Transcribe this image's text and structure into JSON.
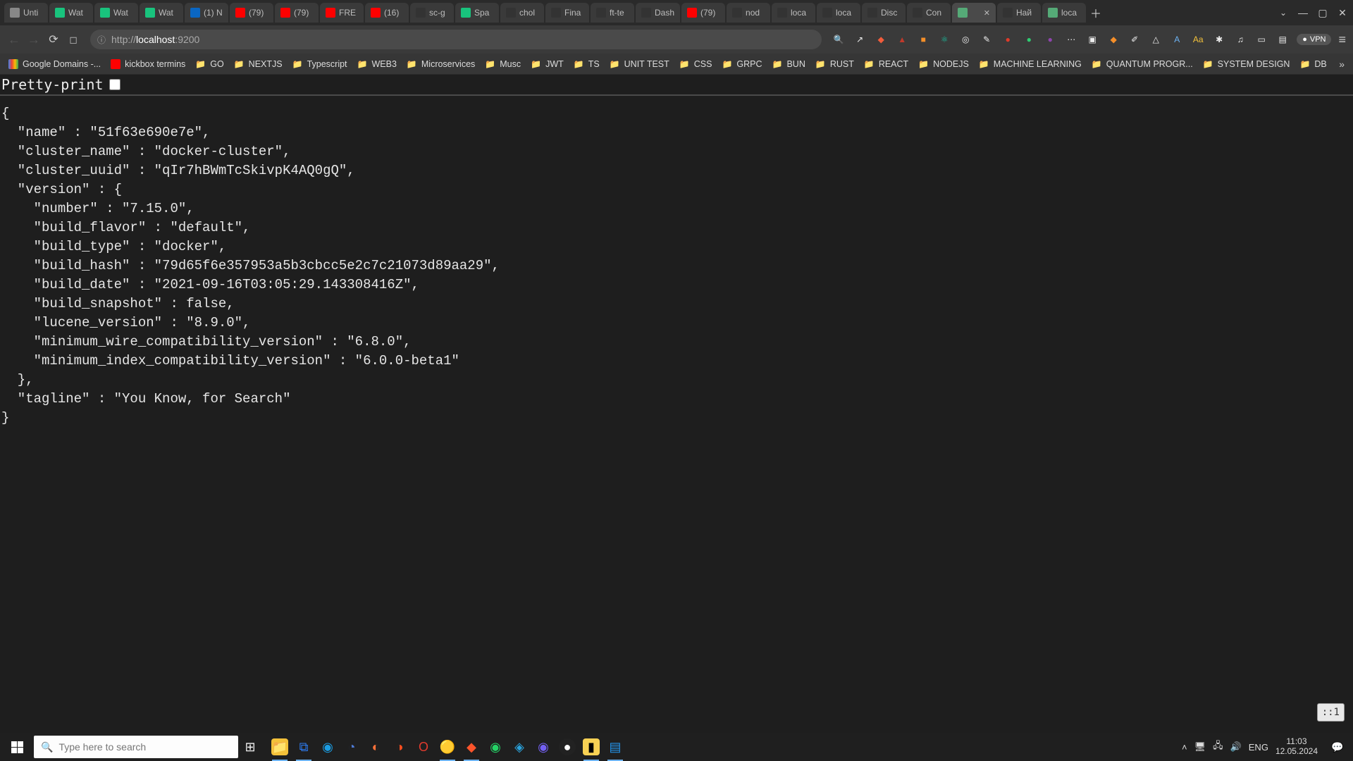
{
  "tabs": [
    {
      "title": "Unti"
    },
    {
      "title": "Wat"
    },
    {
      "title": "Wat"
    },
    {
      "title": "Wat"
    },
    {
      "title": "(1) N"
    },
    {
      "title": "(79)"
    },
    {
      "title": "(79)"
    },
    {
      "title": "FRE"
    },
    {
      "title": "(16)"
    },
    {
      "title": "sc-g"
    },
    {
      "title": "Spa"
    },
    {
      "title": "chol"
    },
    {
      "title": "Fina"
    },
    {
      "title": "ft-te"
    },
    {
      "title": "Dash"
    },
    {
      "title": "(79)"
    },
    {
      "title": "nod"
    },
    {
      "title": "loca"
    },
    {
      "title": "loca"
    },
    {
      "title": "Disc"
    },
    {
      "title": "Con"
    },
    {
      "title": ""
    },
    {
      "title": "Най"
    },
    {
      "title": "loca"
    }
  ],
  "url": {
    "display_host": "localhost",
    "display_port": ":9200",
    "prefix": "http://"
  },
  "vpn_label": "VPN",
  "bookmarks": [
    {
      "label": "Google Domains -...",
      "type": "site"
    },
    {
      "label": "kickbox termins",
      "type": "site-yt"
    },
    {
      "label": "GO",
      "type": "folder"
    },
    {
      "label": "NEXTJS",
      "type": "folder"
    },
    {
      "label": "Typescript",
      "type": "folder"
    },
    {
      "label": "WEB3",
      "type": "folder"
    },
    {
      "label": "Microservices",
      "type": "folder"
    },
    {
      "label": "Musc",
      "type": "folder"
    },
    {
      "label": "JWT",
      "type": "folder"
    },
    {
      "label": "TS",
      "type": "folder"
    },
    {
      "label": "UNIT TEST",
      "type": "folder"
    },
    {
      "label": "CSS",
      "type": "folder"
    },
    {
      "label": "GRPC",
      "type": "folder"
    },
    {
      "label": "BUN",
      "type": "folder"
    },
    {
      "label": "RUST",
      "type": "folder"
    },
    {
      "label": "REACT",
      "type": "folder"
    },
    {
      "label": "NODEJS",
      "type": "folder"
    },
    {
      "label": "MACHINE LEARNING",
      "type": "folder"
    },
    {
      "label": "QUANTUM PROGR...",
      "type": "folder"
    },
    {
      "label": "SYSTEM DESIGN",
      "type": "folder"
    },
    {
      "label": "DB",
      "type": "folder"
    }
  ],
  "pretty_print_label": "Pretty-print",
  "json_body": {
    "name": "51f63e690e7e",
    "cluster_name": "docker-cluster",
    "cluster_uuid": "qIr7hBWmTcSkivpK4AQ0gQ",
    "version": {
      "number": "7.15.0",
      "build_flavor": "default",
      "build_type": "docker",
      "build_hash": "79d65f6e357953a5b3cbcc5e2c7c21073d89aa29",
      "build_date": "2021-09-16T03:05:29.143308416Z",
      "build_snapshot": "false",
      "lucene_version": "8.9.0",
      "minimum_wire_compatibility_version": "6.8.0",
      "minimum_index_compatibility_version": "6.0.0-beta1"
    },
    "tagline": "You Know, for Search"
  },
  "float_badge": "::1",
  "taskbar": {
    "search_placeholder": "Type here to search",
    "lang": "ENG",
    "time": "11:03",
    "date": "12.05.2024"
  }
}
